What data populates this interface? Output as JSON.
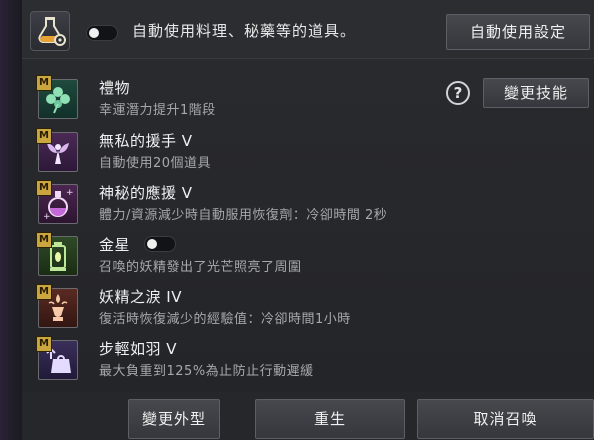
{
  "top": {
    "auto_use_label": "自動使用料理、秘藥等的道具。",
    "auto_use_settings_button": "自動使用設定",
    "auto_use_toggle_on": false
  },
  "help_label": "?",
  "change_skill_button": "變更技能",
  "badge_label": "M",
  "skills": [
    {
      "name": "禮物",
      "desc": "幸運潛力提升1階段",
      "icon": "clover-icon"
    },
    {
      "name": "無私的援手 V",
      "desc": "自動使用20個道具",
      "icon": "fairy-icon"
    },
    {
      "name": "神秘的應援 V",
      "desc": "體力/資源減少時自動服用恢復劑：冷卻時間 2秒",
      "icon": "potion-icon"
    },
    {
      "name": "金星",
      "desc": "召喚的妖精發出了光芒照亮了周圍",
      "icon": "lantern-icon",
      "toggle_on": false
    },
    {
      "name": "妖精之淚 IV",
      "desc": "復活時恢復減少的經驗值：冷卻時間1小時",
      "icon": "tear-vase-icon"
    },
    {
      "name": "步輕如羽 V",
      "desc": "最大負重到125%為止防止行動遲緩",
      "icon": "weight-icon"
    }
  ],
  "bottom": {
    "change_appearance": "變更外型",
    "revive": "重生",
    "cancel_summon": "取消召喚"
  },
  "colors": {
    "badge": "#c9a640",
    "background": "#232428",
    "button": "#3e4045"
  }
}
